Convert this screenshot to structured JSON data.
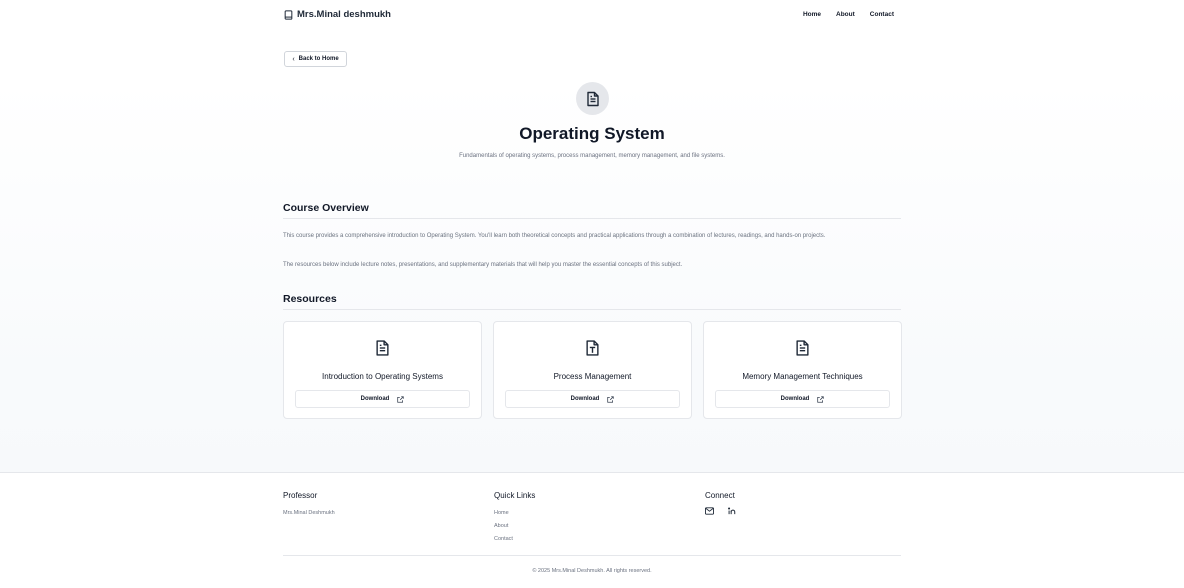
{
  "header": {
    "brand": "Mrs.Minal deshmukh",
    "nav": [
      "Home",
      "About",
      "Contact"
    ]
  },
  "back_button": "Back to Home",
  "course": {
    "title": "Operating System",
    "subtitle": "Fundamentals of operating systems, process management, memory management, and file systems."
  },
  "overview": {
    "heading": "Course Overview",
    "paragraph1": "This course provides a comprehensive introduction to Operating System. You'll learn both theoretical concepts and practical applications through a combination of lectures, readings, and hands-on projects.",
    "paragraph2": "The resources below include lecture notes, presentations, and supplementary materials that will help you master the essential concepts of this subject."
  },
  "resources": {
    "heading": "Resources",
    "items": [
      {
        "title": "Introduction to Operating Systems",
        "icon": "document-icon",
        "button": "Download"
      },
      {
        "title": "Process Management",
        "icon": "text-file-icon",
        "button": "Download"
      },
      {
        "title": "Memory Management Techniques",
        "icon": "document-icon",
        "button": "Download"
      }
    ]
  },
  "footer": {
    "professor": {
      "heading": "Professor",
      "name": "Mrs.Minal Deshmukh"
    },
    "quick_links": {
      "heading": "Quick Links",
      "links": [
        "Home",
        "About",
        "Contact"
      ]
    },
    "connect": {
      "heading": "Connect",
      "icons": [
        "mail-icon",
        "linkedin-icon"
      ]
    },
    "copyright": "© 2025 Mrs.Minal Deshmukh. All rights reserved."
  }
}
